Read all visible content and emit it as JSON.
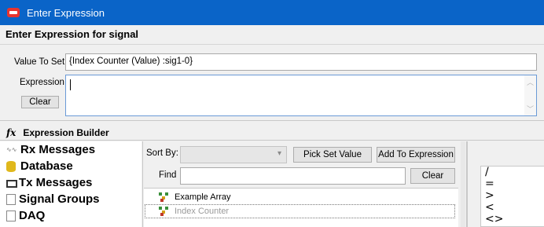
{
  "window": {
    "title": "Enter Expression"
  },
  "heading": "Enter Expression for signal",
  "value_to_set": {
    "label": "Value To Set",
    "value": "{Index Counter (Value) :sig1-0}"
  },
  "expression": {
    "label": "Expression",
    "value": "",
    "clear_label": "Clear"
  },
  "expression_builder": {
    "title": "Expression Builder",
    "tree": [
      {
        "label": "Rx Messages",
        "icon": "rx-messages-icon"
      },
      {
        "label": "Database",
        "icon": "database-icon"
      },
      {
        "label": "Tx Messages",
        "icon": "tx-messages-icon"
      },
      {
        "label": "Signal Groups",
        "icon": "signal-groups-icon"
      },
      {
        "label": "DAQ",
        "icon": "daq-icon"
      }
    ],
    "sort_by": {
      "label": "Sort By:",
      "selected": ""
    },
    "pick_set_value_label": "Pick Set Value",
    "add_to_expression_label": "Add To Expression",
    "find": {
      "label": "Find",
      "value": "",
      "clear_label": "Clear"
    },
    "items": [
      {
        "label": "Example Array",
        "selected": false
      },
      {
        "label": "Index Counter",
        "selected": true
      }
    ],
    "operators": [
      "/",
      "=",
      ">",
      "<",
      "<>"
    ]
  },
  "colors": {
    "titlebar": "#0a64c8",
    "focus_border": "#6a9ad6"
  }
}
